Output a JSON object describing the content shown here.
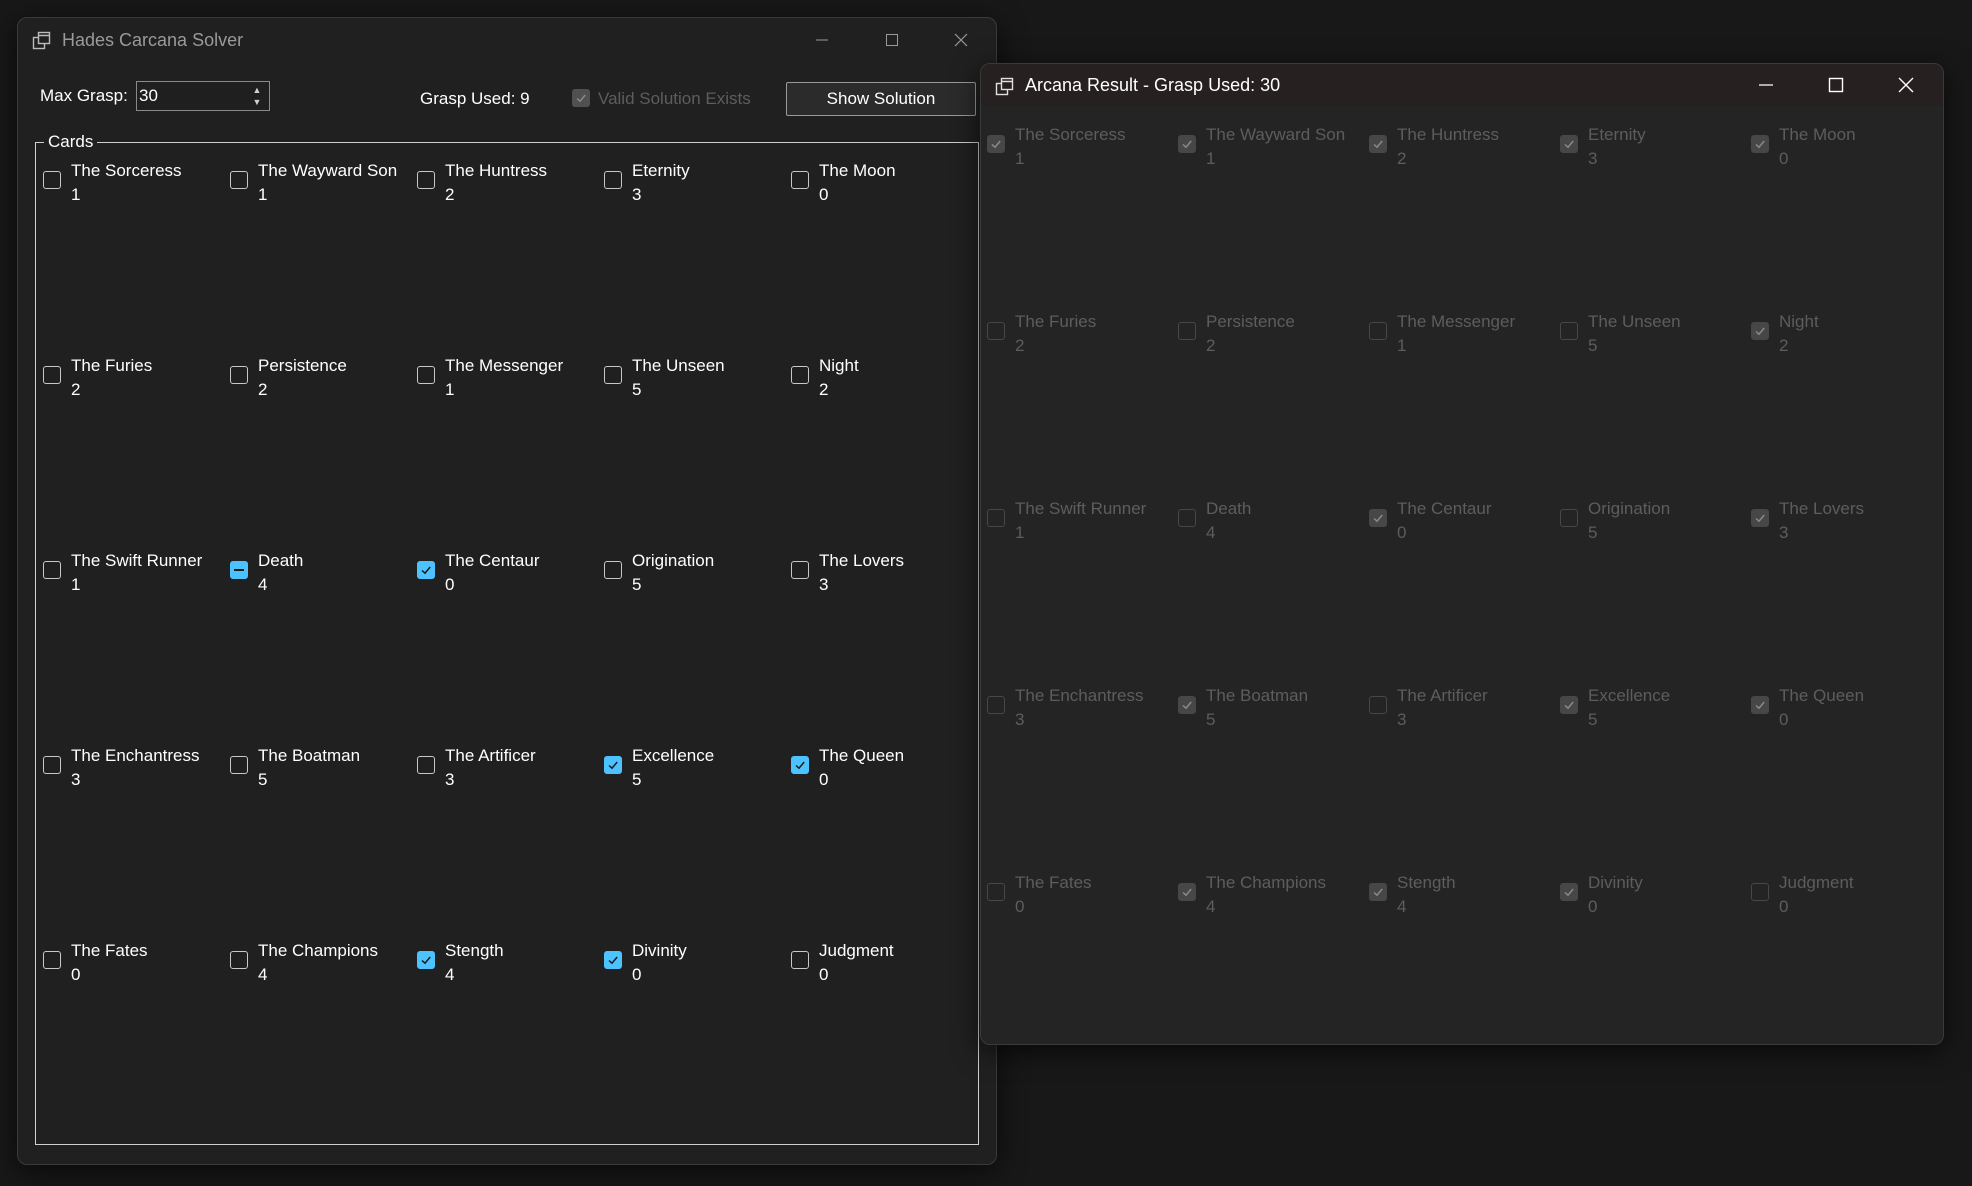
{
  "main": {
    "title": "Hades Carcana Solver",
    "max_grasp_label": "Max Grasp:",
    "max_grasp_value": "30",
    "grasp_used": "Grasp Used: 9",
    "valid_solution_label": "Valid Solution Exists",
    "show_solution_label": "Show Solution",
    "group_label": "Cards",
    "cards": [
      {
        "name": "The Sorceress",
        "grasp": "1",
        "state": "unchecked"
      },
      {
        "name": "The Wayward Son",
        "grasp": "1",
        "state": "unchecked"
      },
      {
        "name": "The Huntress",
        "grasp": "2",
        "state": "unchecked"
      },
      {
        "name": "Eternity",
        "grasp": "3",
        "state": "unchecked"
      },
      {
        "name": "The Moon",
        "grasp": "0",
        "state": "unchecked"
      },
      {
        "name": "The Furies",
        "grasp": "2",
        "state": "unchecked"
      },
      {
        "name": "Persistence",
        "grasp": "2",
        "state": "unchecked"
      },
      {
        "name": "The Messenger",
        "grasp": "1",
        "state": "unchecked"
      },
      {
        "name": "The Unseen",
        "grasp": "5",
        "state": "unchecked"
      },
      {
        "name": "Night",
        "grasp": "2",
        "state": "unchecked"
      },
      {
        "name": "The Swift Runner",
        "grasp": "1",
        "state": "unchecked"
      },
      {
        "name": "Death",
        "grasp": "4",
        "state": "indeterminate"
      },
      {
        "name": "The Centaur",
        "grasp": "0",
        "state": "checked"
      },
      {
        "name": "Origination",
        "grasp": "5",
        "state": "unchecked"
      },
      {
        "name": "The Lovers",
        "grasp": "3",
        "state": "unchecked"
      },
      {
        "name": "The Enchantress",
        "grasp": "3",
        "state": "unchecked"
      },
      {
        "name": "The Boatman",
        "grasp": "5",
        "state": "unchecked"
      },
      {
        "name": "The Artificer",
        "grasp": "3",
        "state": "unchecked"
      },
      {
        "name": "Excellence",
        "grasp": "5",
        "state": "checked"
      },
      {
        "name": "The Queen",
        "grasp": "0",
        "state": "checked"
      },
      {
        "name": "The Fates",
        "grasp": "0",
        "state": "unchecked"
      },
      {
        "name": "The Champions",
        "grasp": "4",
        "state": "unchecked"
      },
      {
        "name": "Stength",
        "grasp": "4",
        "state": "checked"
      },
      {
        "name": "Divinity",
        "grasp": "0",
        "state": "checked"
      },
      {
        "name": "Judgment",
        "grasp": "0",
        "state": "unchecked"
      }
    ]
  },
  "result": {
    "title": "Arcana Result - Grasp Used: 30",
    "cards": [
      {
        "name": "The Sorceress",
        "grasp": "1",
        "state": "checked"
      },
      {
        "name": "The Wayward Son",
        "grasp": "1",
        "state": "checked"
      },
      {
        "name": "The Huntress",
        "grasp": "2",
        "state": "checked"
      },
      {
        "name": "Eternity",
        "grasp": "3",
        "state": "checked"
      },
      {
        "name": "The Moon",
        "grasp": "0",
        "state": "checked"
      },
      {
        "name": "The Furies",
        "grasp": "2",
        "state": "unchecked"
      },
      {
        "name": "Persistence",
        "grasp": "2",
        "state": "unchecked"
      },
      {
        "name": "The Messenger",
        "grasp": "1",
        "state": "unchecked"
      },
      {
        "name": "The Unseen",
        "grasp": "5",
        "state": "unchecked"
      },
      {
        "name": "Night",
        "grasp": "2",
        "state": "checked"
      },
      {
        "name": "The Swift Runner",
        "grasp": "1",
        "state": "unchecked"
      },
      {
        "name": "Death",
        "grasp": "4",
        "state": "unchecked"
      },
      {
        "name": "The Centaur",
        "grasp": "0",
        "state": "checked"
      },
      {
        "name": "Origination",
        "grasp": "5",
        "state": "unchecked"
      },
      {
        "name": "The Lovers",
        "grasp": "3",
        "state": "checked"
      },
      {
        "name": "The Enchantress",
        "grasp": "3",
        "state": "unchecked"
      },
      {
        "name": "The Boatman",
        "grasp": "5",
        "state": "checked"
      },
      {
        "name": "The Artificer",
        "grasp": "3",
        "state": "unchecked"
      },
      {
        "name": "Excellence",
        "grasp": "5",
        "state": "checked"
      },
      {
        "name": "The Queen",
        "grasp": "0",
        "state": "checked"
      },
      {
        "name": "The Fates",
        "grasp": "0",
        "state": "unchecked"
      },
      {
        "name": "The Champions",
        "grasp": "4",
        "state": "checked"
      },
      {
        "name": "Stength",
        "grasp": "4",
        "state": "checked"
      },
      {
        "name": "Divinity",
        "grasp": "0",
        "state": "checked"
      },
      {
        "name": "Judgment",
        "grasp": "0",
        "state": "unchecked"
      }
    ]
  },
  "colors": {
    "accent": "#4cc2ff",
    "window_bg": "#202020",
    "desktop_bg": "#181818",
    "disabled_text": "#5d5d5d"
  },
  "icons": {
    "app": "app-window-icon",
    "minimize": "minimize-icon",
    "maximize": "maximize-icon",
    "close": "close-icon",
    "spin_up": "spin-up-icon",
    "spin_down": "spin-down-icon",
    "check": "checkmark-icon"
  }
}
